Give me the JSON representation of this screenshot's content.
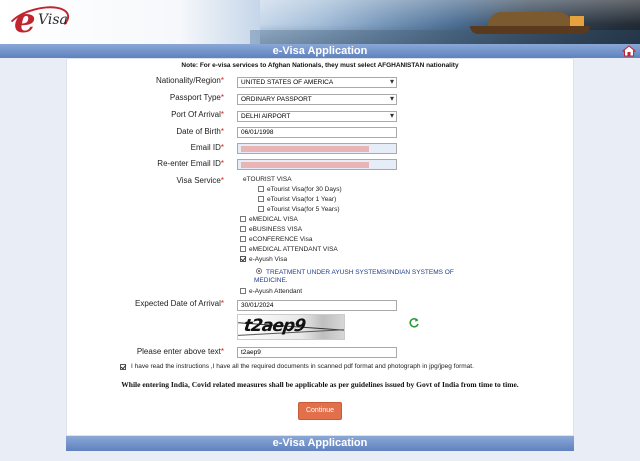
{
  "header": {
    "logo_e": "e",
    "logo_visa": "Visa",
    "title": "e-Visa Application"
  },
  "form": {
    "note": "Note: For e-visa services to Afghan Nationals, they must select AFGHANISTAN nationality",
    "nationality": {
      "label": "Nationality/Region",
      "value": "UNITED STATES OF AMERICA"
    },
    "passport_type": {
      "label": "Passport Type",
      "value": "ORDINARY PASSPORT"
    },
    "port_of_arrival": {
      "label": "Port Of Arrival",
      "value": "DELHI AIRPORT"
    },
    "dob": {
      "label": "Date of Birth",
      "value": "06/01/1998"
    },
    "email": {
      "label": "Email ID"
    },
    "reemail": {
      "label": "Re-enter Email ID"
    },
    "visa_service": {
      "label": "Visa Service",
      "etourist_heading": "eTOURIST VISA",
      "etourist_options": [
        {
          "label": "eTourist Visa(for 30 Days)",
          "checked": false
        },
        {
          "label": "eTourist Visa(for 1 Year)",
          "checked": false
        },
        {
          "label": "eTourist Visa(for 5 Years)",
          "checked": false
        }
      ],
      "other_options": [
        {
          "label": "eMEDICAL VISA",
          "checked": false
        },
        {
          "label": "eBUSINESS VISA",
          "checked": false
        },
        {
          "label": "eCONFERENCE Visa",
          "checked": false
        },
        {
          "label": "eMEDICAL ATTENDANT VISA",
          "checked": false
        },
        {
          "label": "e-Ayush Visa",
          "checked": true
        }
      ],
      "ayush_sub_option": {
        "label": "TREATMENT UNDER AYUSH SYSTEMS/INDIAN SYSTEMS OF MEDICINE.",
        "selected": true
      },
      "ayush_attendant": {
        "label": "e-Ayush Attendant",
        "checked": false
      }
    },
    "arrival_date": {
      "label": "Expected Date of Arrival",
      "value": "30/01/2024"
    },
    "captcha": {
      "image_text": "t2aep9",
      "label": "Please enter above text",
      "value": "t2aep9"
    },
    "declaration": {
      "text": "I have read the instructions ,I have all the required documents in scanned pdf format and photograph in jpg/jpeg format.",
      "checked": true
    },
    "covid_notice": "While entering India, Covid related measures shall be applicable as per guidelines issued by Govt of India from time to time.",
    "continue_label": "Continue",
    "required_mark": "*"
  },
  "footer": {
    "title": "e-Visa Application"
  },
  "icons": {
    "home": "home-icon",
    "refresh": "refresh-icon"
  },
  "colors": {
    "title_bar": "#6f90c8",
    "button": "#e2704b",
    "required": "#d42020"
  }
}
